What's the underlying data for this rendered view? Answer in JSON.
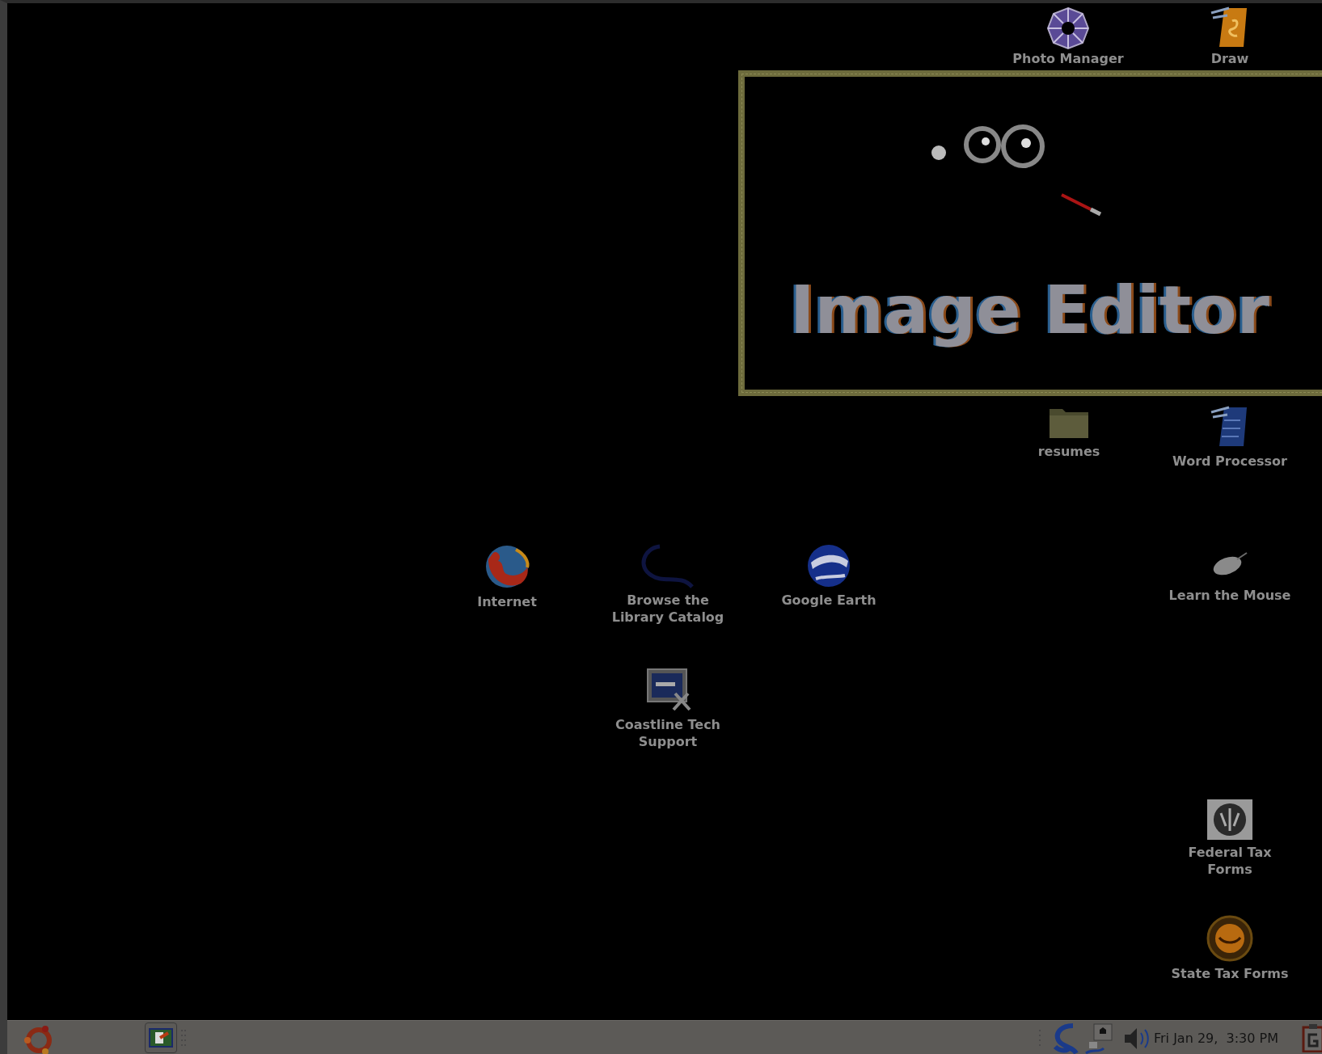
{
  "desktop_icons": [
    {
      "label": "Photo Manager"
    },
    {
      "label": "Draw"
    },
    {
      "label": "resumes"
    },
    {
      "label": "Word Processor"
    },
    {
      "label": "Internet"
    },
    {
      "label": "Browse the Library Catalog"
    },
    {
      "label": "Google Earth"
    },
    {
      "label": "Learn the Mouse"
    },
    {
      "label": "Coastline Tech Support"
    },
    {
      "label": "Federal Tax Forms"
    },
    {
      "label": "State Tax Forms"
    }
  ],
  "splash": {
    "title": "Image Editor"
  },
  "taskbar": {
    "clock": "Fri Jan 29,  3:30 PM"
  }
}
